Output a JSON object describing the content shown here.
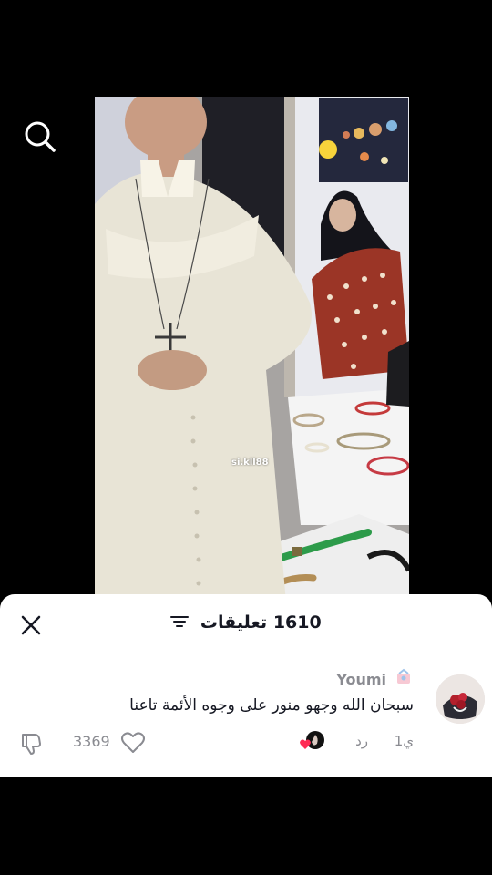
{
  "video": {
    "watermark": "si.kll88"
  },
  "comments_panel": {
    "count_label": "1610 تعليقات",
    "comment": {
      "username": "Youmi",
      "text": "سبحان الله وجهو منور على وجوه الأئمة تاعنا",
      "time": "1ي",
      "reply_label": "رد",
      "like_count": "3369"
    }
  },
  "icons": {
    "search": "search-icon",
    "close": "close-icon",
    "filter": "filter-icon",
    "like": "heart-icon",
    "dislike": "thumbs-down-icon"
  },
  "colors": {
    "text_primary": "#161823",
    "text_secondary": "#8a8b91",
    "liked_heart": "#fe2c55"
  }
}
